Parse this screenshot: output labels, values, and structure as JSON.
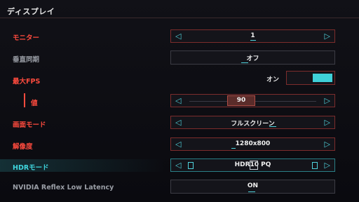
{
  "header": {
    "title": "ディスプレイ"
  },
  "settings": {
    "monitor": {
      "label": "モニター",
      "value": "1"
    },
    "vsync": {
      "label": "垂直同期",
      "value": "オフ"
    },
    "max_fps": {
      "label": "最大FPS",
      "toggle_label": "オン",
      "enabled": true
    },
    "fps_value": {
      "label": "値",
      "value": "90"
    },
    "screen_mode": {
      "label": "画面モード",
      "value": "フルスクリーン"
    },
    "resolution": {
      "label": "解像度",
      "value": "1280x800"
    },
    "hdr_mode": {
      "label": "HDRモード",
      "value": "HDR10 PQ"
    },
    "nvidia_reflex": {
      "label": "NVIDIA Reflex Low Latency",
      "value": "ON"
    }
  },
  "icons": {
    "left_arrow": "◁",
    "right_arrow": "▷",
    "hdr_left": "HDR-off-icon",
    "hdr_right": "HDR-on-icon"
  },
  "colors": {
    "accent_red": "#ff4b3e",
    "accent_cyan": "#3fd6de",
    "background": "#0b0b10"
  }
}
